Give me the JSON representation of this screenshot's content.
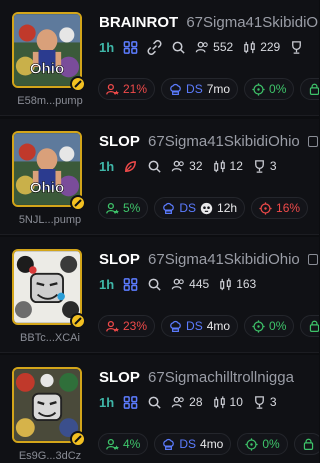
{
  "tokens": [
    {
      "address": "E58m...pump",
      "ticker": "BRAINROT",
      "name": "67Sigma41SkibidiOhio",
      "age": "1h",
      "holders": "552",
      "pro_traders": "229",
      "top_holders_pct": "21%",
      "dev_label": "DS",
      "dev_time": "7mo",
      "snipers_pct": "0%",
      "color": "#f04a4a",
      "image_text": "Ohio",
      "show_link_icon": true,
      "show_trophy": true,
      "trophy_count": ""
    },
    {
      "address": "5NJL...pump",
      "ticker": "SLOP",
      "name": "67Sigma41SkibidiOhio",
      "age": "1h",
      "holders": "32",
      "pro_traders": "12",
      "trophy_count": "3",
      "top_holders_pct": "5%",
      "dev_label": "DS",
      "dev_time": "12h",
      "snipers_pct": "16%",
      "image_text": "Ohio"
    },
    {
      "address": "BBTc...XCAi",
      "ticker": "SLOP",
      "name": "67Sigma41SkibidiOhio",
      "age": "1h",
      "holders": "445",
      "pro_traders": "163",
      "top_holders_pct": "23%",
      "dev_label": "DS",
      "dev_time": "4mo",
      "snipers_pct": "0%"
    },
    {
      "address": "Es9G...3dCz",
      "ticker": "SLOP",
      "name": "67Sigmachilltrollnigga",
      "age": "1h",
      "holders": "28",
      "pro_traders": "10",
      "trophy_count": "3",
      "top_holders_pct": "4%",
      "dev_label": "DS",
      "dev_time": "4mo",
      "snipers_pct": "0%"
    }
  ],
  "colors": {
    "accent_gold": "#d3a51a",
    "age_teal": "#3fb6a8",
    "red": "#f04a4a",
    "green": "#3ec46a",
    "blue": "#5c7cff"
  }
}
